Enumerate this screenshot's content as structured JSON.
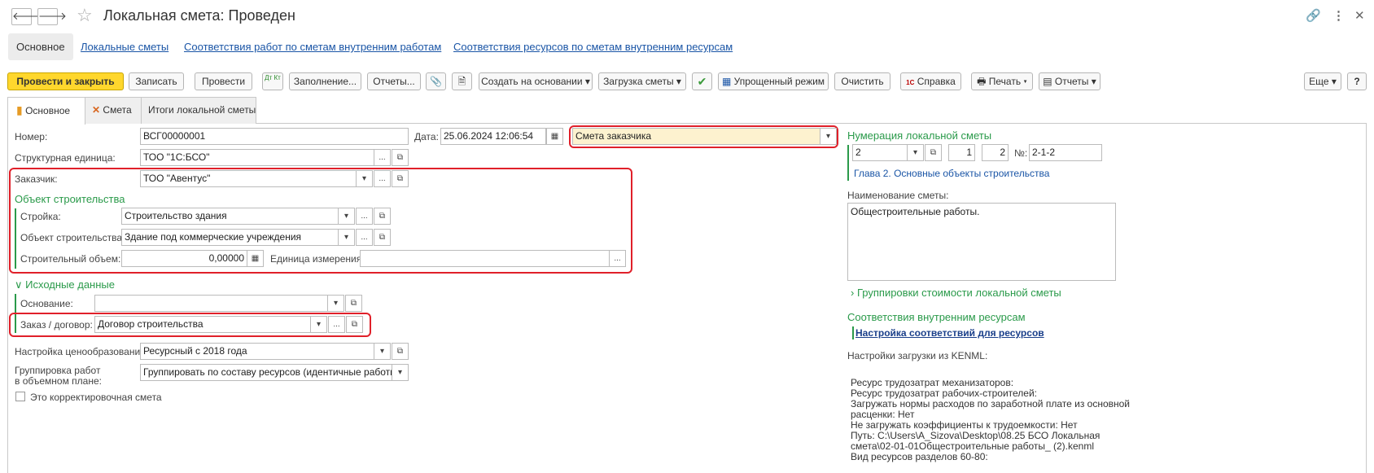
{
  "window": {
    "title": "Локальная смета: Проведен",
    "back_arrow": "🡐",
    "forward_arrow": "🡒",
    "star": "☆",
    "link_icon": "🔗",
    "more_icon": "⋮",
    "close_icon": "✕"
  },
  "top_tabs": [
    "Основное",
    "Локальные сметы",
    "Соответствия работ по сметам внутренним работам",
    "Соответствия ресурсов по сметам внутренним ресурсам"
  ],
  "toolbar": {
    "post_close": "Провести и закрыть",
    "save": "Записать",
    "post": "Провести",
    "dtkt": "Дт Кт",
    "fill": "Заполнение...",
    "reports_dots": "Отчеты...",
    "clip_icon": "📎",
    "doc_icon": "🗎",
    "create_based": "Создать на основании ▾",
    "load_estimate": "Загрузка сметы ▾",
    "check_icon": "✔",
    "simple_mode": "Упрощенный режим",
    "clear": "Очистить",
    "help": "Справка",
    "help_icon": "1С",
    "print": "Печать ▾",
    "print_icon": "🖶",
    "reports": "Отчеты ▾",
    "reports_icon": "▤",
    "more": "Еще ▾",
    "question": "?"
  },
  "doc_tabs": [
    "Основное",
    "Смета",
    "Итоги локальной сметы"
  ],
  "form": {
    "number_label": "Номер:",
    "number": "ВСГ00000001",
    "date_label": "Дата:",
    "date": "25.06.2024 12:06:54",
    "estimate_type": "Смета заказчика",
    "struct_unit_label": "Структурная единица:",
    "struct_unit": "ТОО \"1С:БСО\"",
    "customer_label": "Заказчик:",
    "customer": "ТОО \"Авентус\"",
    "object_section": "Объект строительства",
    "site_label": "Стройка:",
    "site": "Строительство здания",
    "object_label": "Объект строительства:",
    "object": "Здание под коммерческие учреждения",
    "volume_label": "Строительный объем:",
    "volume": "0,00000",
    "unit_label": "Единица измерения:",
    "unit": "",
    "source_section": "Исходные данные",
    "basis_label": "Основание:",
    "basis": "",
    "order_label": "Заказ / договор:",
    "order": "Договор строительства",
    "pricing_label": "Настройка ценообразования:",
    "pricing": "Ресурсный с 2018 года",
    "grouping_label_1": "Группировка работ",
    "grouping_label_2": "в объемном плане:",
    "grouping": "Группировать по составу ресурсов (идентичные работы с р",
    "corrective_label": "Это корректировочная смета",
    "dots": "...",
    "dropdown": "▾",
    "open": "⧉",
    "calendar": "▦"
  },
  "right": {
    "numbering_title": "Нумерация локальной сметы",
    "num_chapter": "2",
    "num_a": "1",
    "num_b": "2",
    "num_label": "№:",
    "num_full": "2-1-2",
    "chapter_name": "Глава 2. Основные объекты строительства",
    "estimate_name_label": "Наименование сметы:",
    "estimate_name": "Общестроительные работы.",
    "cost_groups": "Группировки стоимости локальной сметы",
    "resources_title": "Соответствия внутренним ресурсам",
    "resources_link": "Настройка соответствий для ресурсов",
    "kenml_title": "Настройки загрузки из KENML:",
    "kenml_lines": [
      "Ресурс трудозатрат механизаторов:",
      "Ресурс трудозатрат рабочих-строителей:",
      "Загружать нормы расходов по заработной плате из основной",
      "расценки: Нет",
      "Не загружать коэффициенты к трудоемкости: Нет",
      "Путь: C:\\Users\\A_Sizova\\Desktop\\08.25 БСО Локальная",
      "смета\\02-01-01Общестроительные работы_ (2).kenml",
      "Вид ресурсов разделов 60-80:"
    ]
  }
}
